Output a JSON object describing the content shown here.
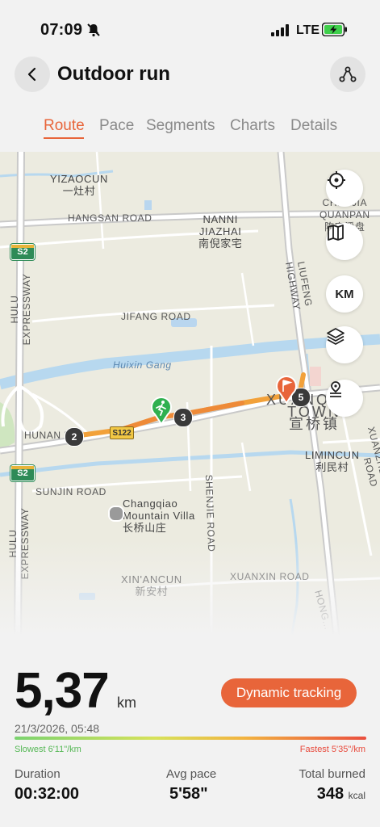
{
  "status_bar": {
    "time": "07:09",
    "network": "LTE"
  },
  "header": {
    "title": "Outdoor run"
  },
  "tabs": [
    {
      "label": "Route",
      "active": true
    },
    {
      "label": "Pace",
      "active": false
    },
    {
      "label": "Segments",
      "active": false
    },
    {
      "label": "Charts",
      "active": false
    },
    {
      "label": "Details",
      "active": false
    }
  ],
  "map": {
    "places": {
      "yizaocun": "YIZAOCUN",
      "yizaocun_cn": "一灶村",
      "nanni": "NANNI",
      "jiazhai": "JIAZHAI",
      "nanni_cn": "南倪家宅",
      "chenjia": "CHENJIA",
      "quanpan": "QUANPAN",
      "chenjia_cn": "陈家潘盘",
      "xuanqiao": "XUANQIAO TOWN",
      "xuanqiao_cn": "宣桥镇",
      "limincun": "LIMINCUN",
      "limincun_cn": "利民村",
      "changqiao": "Changqiao",
      "mountain_villa": "Mountain Villa",
      "changqiao_cn": "长桥山庄",
      "xinancun": "XIN'ANCUN",
      "xinancun_cn": "新安村"
    },
    "roads": {
      "hangsan": "HANGSAN ROAD",
      "jifang": "JIFANG ROAD",
      "huixin_gang": "Huixin Gang",
      "hunan": "HUNAN H",
      "sunjin": "SUNJIN ROAD",
      "shenjie": "SHENJIE ROAD",
      "xuanxin": "XUANXIN ROAD",
      "liufeng": "LIUFENG HIGHWAY",
      "hulu_top": "HULU EXPRESSWAY",
      "hulu_bottom": "HULU EXPRESSWAY",
      "xuanzhen": "XUANZHEN EAST ROAD",
      "hongyi": "HONG..."
    },
    "shields": {
      "s2_top": "S2",
      "s2_bottom": "S2",
      "s122": "S122"
    },
    "kilometer_markers": [
      "2",
      "3",
      "5"
    ],
    "tools": [
      "locate-icon",
      "map-style-icon",
      "KM",
      "layers-icon",
      "route-pin-icon"
    ],
    "km_label": "KM"
  },
  "summary": {
    "distance": "5,37",
    "distance_unit": "km",
    "date": "21/3/2026, 05:48",
    "dynamic_tracking_label": "Dynamic tracking",
    "slowest": "Slowest 6'11\"/km",
    "fastest": "Fastest 5'35\"/km",
    "duration_label": "Duration",
    "duration": "00:32:00",
    "avg_pace_label": "Avg pace",
    "avg_pace": "5'58\"",
    "calories_label": "Total burned",
    "calories": "348",
    "calories_unit": "kcal"
  },
  "colors": {
    "accent": "#e8653a",
    "route_start": "#2fb04f",
    "route_end": "#e8653a"
  }
}
